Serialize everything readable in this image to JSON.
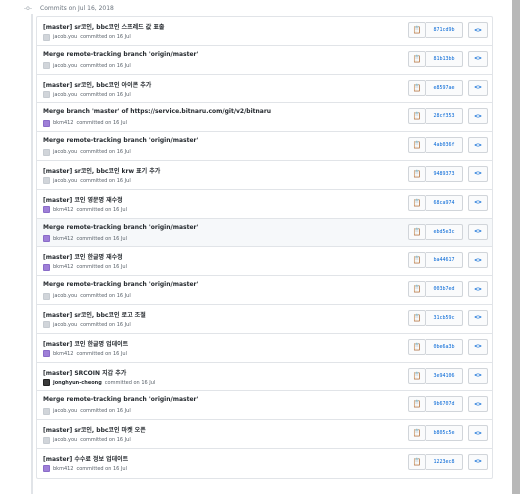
{
  "header": {
    "title": "Commits on Jul 16, 2018",
    "node_icon": "git-commit-icon"
  },
  "commit_suffix": "committed on 16 Jul",
  "icons": {
    "copy": "clipboard-icon",
    "browse": "code-icon"
  },
  "commits": [
    {
      "message": "[master] sr코인, bbc코인 스프레드 값 표출",
      "author": "jacob.you",
      "avatar": "gray",
      "sha": "871cd9b"
    },
    {
      "message": "Merge remote-tracking branch 'origin/master'",
      "author": "jacob.you",
      "avatar": "gray",
      "sha": "81b13bb"
    },
    {
      "message": "[master] sr코인, bbc코인 아이콘 추가",
      "author": "jacob.you",
      "avatar": "gray",
      "sha": "e8597ae"
    },
    {
      "message": "Merge branch 'master' of https://service.bitnaru.com/git/v2/bitnaru",
      "author": "bkm412",
      "avatar": "purple",
      "sha": "28cf353"
    },
    {
      "message": "Merge remote-tracking branch 'origin/master'",
      "author": "jacob.you",
      "avatar": "gray",
      "sha": "4ab036f"
    },
    {
      "message": "[master] sr코인, bbc코인 krw 표기 추가",
      "author": "jacob.you",
      "avatar": "gray",
      "sha": "9489373"
    },
    {
      "message": "[master] 코인 영문명 재수정",
      "author": "bkm412",
      "avatar": "purple",
      "sha": "68ca974"
    },
    {
      "message": "Merge remote-tracking branch 'origin/master'",
      "author": "bkm412",
      "avatar": "purple",
      "sha": "ebd5e3c",
      "highlight": true
    },
    {
      "message": "[master] 코인 한글명 재수정",
      "author": "bkm412",
      "avatar": "purple",
      "sha": "ba44617"
    },
    {
      "message": "Merge remote-tracking branch 'origin/master'",
      "author": "jacob.you",
      "avatar": "gray",
      "sha": "003b7ed"
    },
    {
      "message": "[master] sr코인, bbc코인 로고 조절",
      "author": "jacob.you",
      "avatar": "gray",
      "sha": "31cb59c"
    },
    {
      "message": "[master] 코인 한글명 업데이트",
      "author": "bkm412",
      "avatar": "purple",
      "sha": "0be6a3b"
    },
    {
      "message": "[master] SRCOIN 지갑 추가",
      "author": "jonghyun-cheong",
      "avatar": "dark",
      "sha": "3e94106",
      "author_bold": true
    },
    {
      "message": "Merge remote-tracking branch 'origin/master'",
      "author": "jacob.you",
      "avatar": "gray",
      "sha": "9b6707d"
    },
    {
      "message": "[master] sr코인, bbc코인 마켓 오픈",
      "author": "jacob.you",
      "avatar": "gray",
      "sha": "b805c5e"
    },
    {
      "message": "[master] 수수료 정보 업데이트",
      "author": "bkm412",
      "avatar": "purple",
      "sha": "1223ec8"
    }
  ]
}
